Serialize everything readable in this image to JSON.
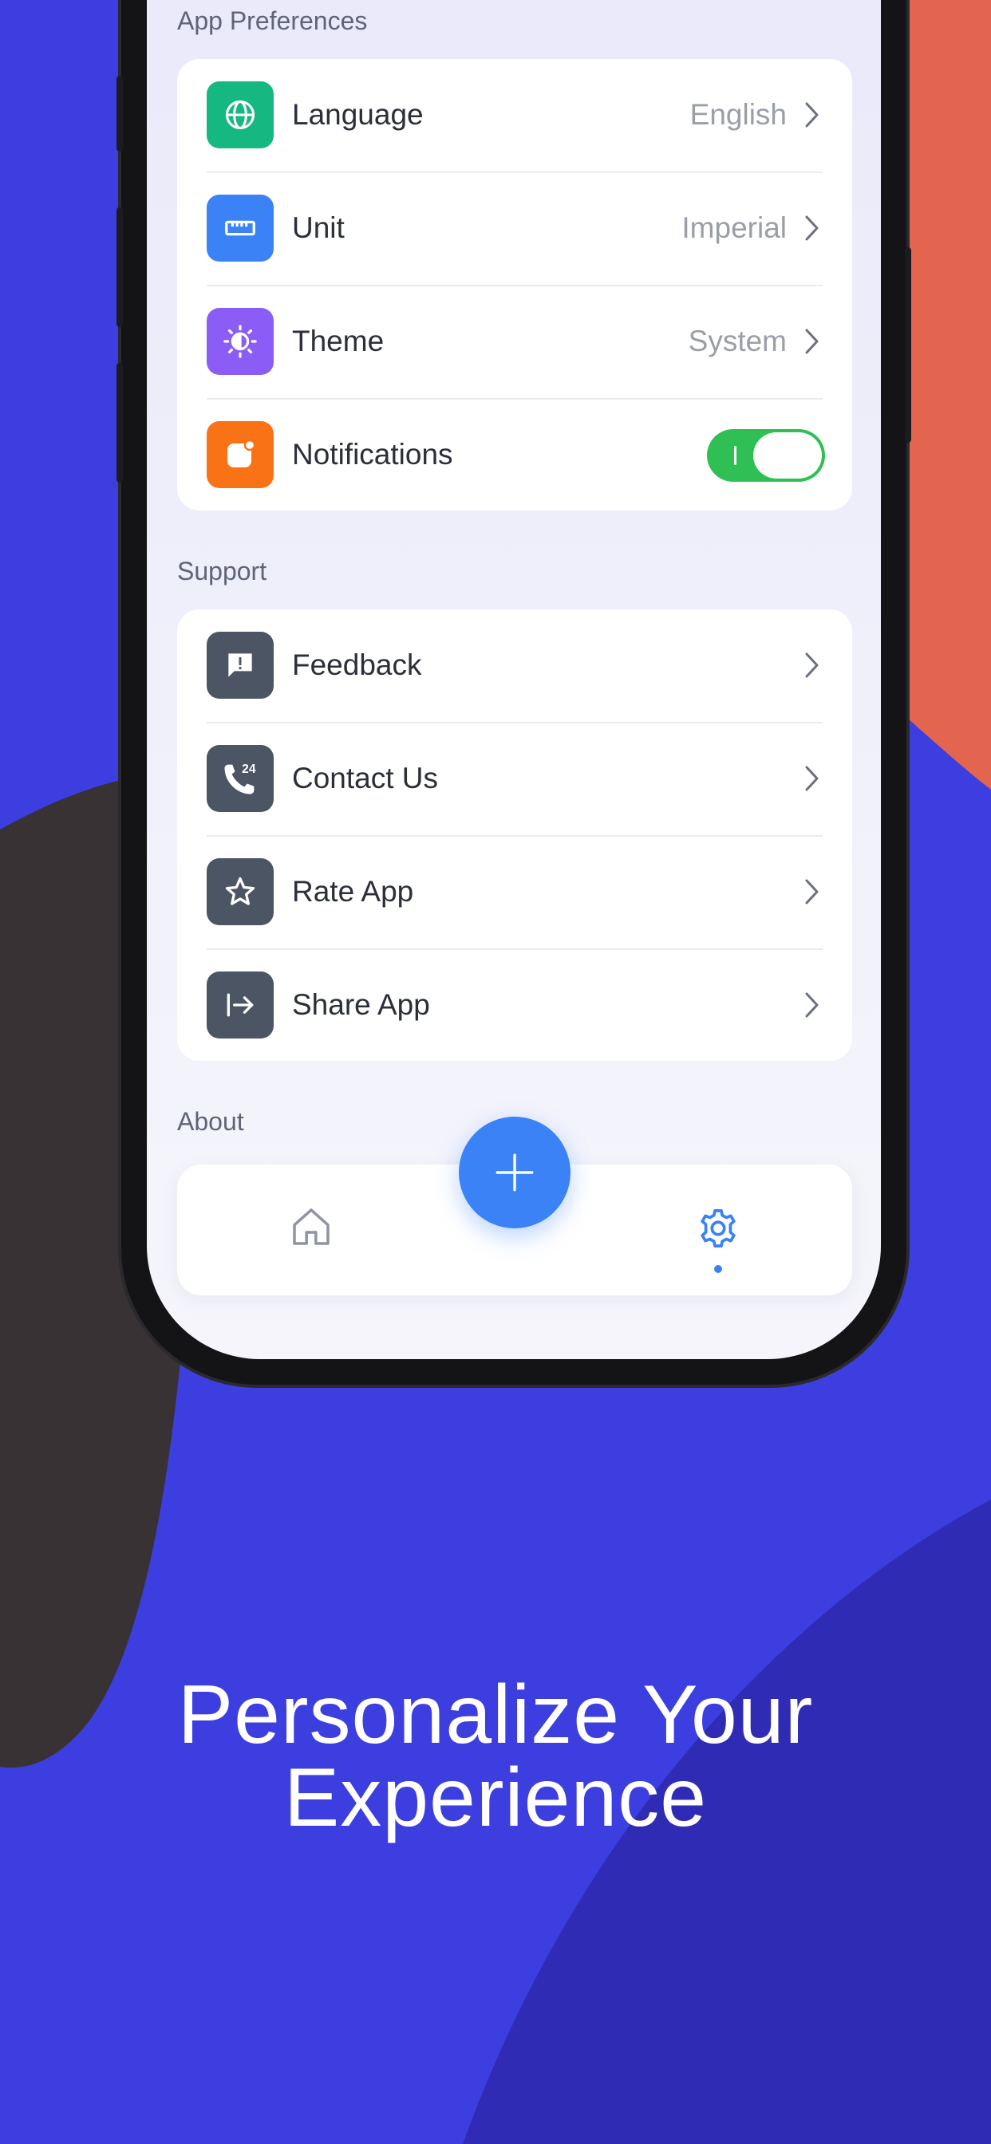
{
  "colors": {
    "background": "#3d3ee0",
    "accent_orange": "#e4654f",
    "dark_blob": "#383234",
    "language_icon_bg": "#16b881",
    "unit_icon_bg": "#3b82f6",
    "theme_icon_bg": "#8b5cf6",
    "notifications_icon_bg": "#f97316",
    "support_icon_bg": "#4b5563",
    "toggle_on": "#2fbf54",
    "fab": "#3b82f6"
  },
  "preferences": {
    "section_label": "App Preferences",
    "items": [
      {
        "label": "Language",
        "value": "English",
        "icon": "globe-icon"
      },
      {
        "label": "Unit",
        "value": "Imperial",
        "icon": "ruler-icon"
      },
      {
        "label": "Theme",
        "value": "System",
        "icon": "theme-icon"
      },
      {
        "label": "Notifications",
        "icon": "notification-icon",
        "toggle_on": true
      }
    ]
  },
  "support": {
    "section_label": "Support",
    "items": [
      {
        "label": "Feedback",
        "icon": "feedback-icon"
      },
      {
        "label": "Contact Us",
        "icon": "phone-24-icon",
        "badge": "24"
      },
      {
        "label": "Rate App",
        "icon": "star-icon"
      },
      {
        "label": "Share App",
        "icon": "share-icon"
      }
    ]
  },
  "about": {
    "section_label": "About"
  },
  "tabbar": {
    "tabs": [
      {
        "name": "home",
        "icon": "home-icon",
        "active": false
      },
      {
        "name": "settings",
        "icon": "gear-icon",
        "active": true
      }
    ],
    "fab_icon": "plus-icon"
  },
  "headline": {
    "line1": "Personalize Your",
    "line2": "Experience"
  }
}
